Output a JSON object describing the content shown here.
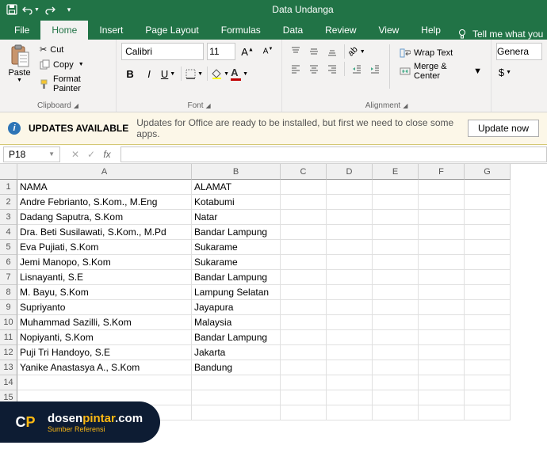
{
  "app": {
    "title": "Data Undanga"
  },
  "qat": {
    "save": "save-icon",
    "undo": "undo-icon",
    "redo": "redo-icon",
    "customize": "customize-icon"
  },
  "tabs": [
    "File",
    "Home",
    "Insert",
    "Page Layout",
    "Formulas",
    "Data",
    "Review",
    "View",
    "Help"
  ],
  "active_tab": "Home",
  "tellme": "Tell me what you",
  "clipboard": {
    "paste": "Paste",
    "cut": "Cut",
    "copy": "Copy",
    "format_painter": "Format Painter",
    "group": "Clipboard"
  },
  "font": {
    "name": "Calibri",
    "size": "11",
    "group": "Font"
  },
  "alignment": {
    "wrap": "Wrap Text",
    "merge": "Merge & Center",
    "group": "Alignment"
  },
  "number": {
    "format": "Genera"
  },
  "msg": {
    "title": "UPDATES AVAILABLE",
    "text": "Updates for Office are ready to be installed, but first we need to close some apps.",
    "button": "Update now"
  },
  "namebox": "P18",
  "formula": "",
  "columns": [
    "A",
    "B",
    "C",
    "D",
    "E",
    "F",
    "G"
  ],
  "row_start": 1,
  "row_end": 16,
  "sheet": {
    "headers": [
      "NAMA",
      "ALAMAT"
    ],
    "rows": [
      [
        "Andre Febrianto, S.Kom., M.Eng",
        "Kotabumi"
      ],
      [
        "Dadang Saputra, S.Kom",
        "Natar"
      ],
      [
        "Dra. Beti Susilawati, S.Kom., M.Pd",
        "Bandar Lampung"
      ],
      [
        "Eva Pujiati, S.Kom",
        "Sukarame"
      ],
      [
        "Jemi Manopo, S.Kom",
        "Sukarame"
      ],
      [
        "Lisnayanti, S.E",
        "Bandar Lampung"
      ],
      [
        "M. Bayu, S.Kom",
        "Lampung Selatan"
      ],
      [
        "Supriyanto",
        "Jayapura"
      ],
      [
        "Muhammad Sazilli, S.Kom",
        "Malaysia"
      ],
      [
        "Nopiyanti, S.Kom",
        "Bandar Lampung"
      ],
      [
        "Puji Tri Handoyo, S.E",
        "Jakarta"
      ],
      [
        "Yanike Anastasya A., S.Kom",
        "Bandung"
      ]
    ]
  },
  "logo": {
    "brand1": "dosen",
    "brand2": "pintar",
    "domain": ".com",
    "tagline": "Sumber Referensi"
  }
}
